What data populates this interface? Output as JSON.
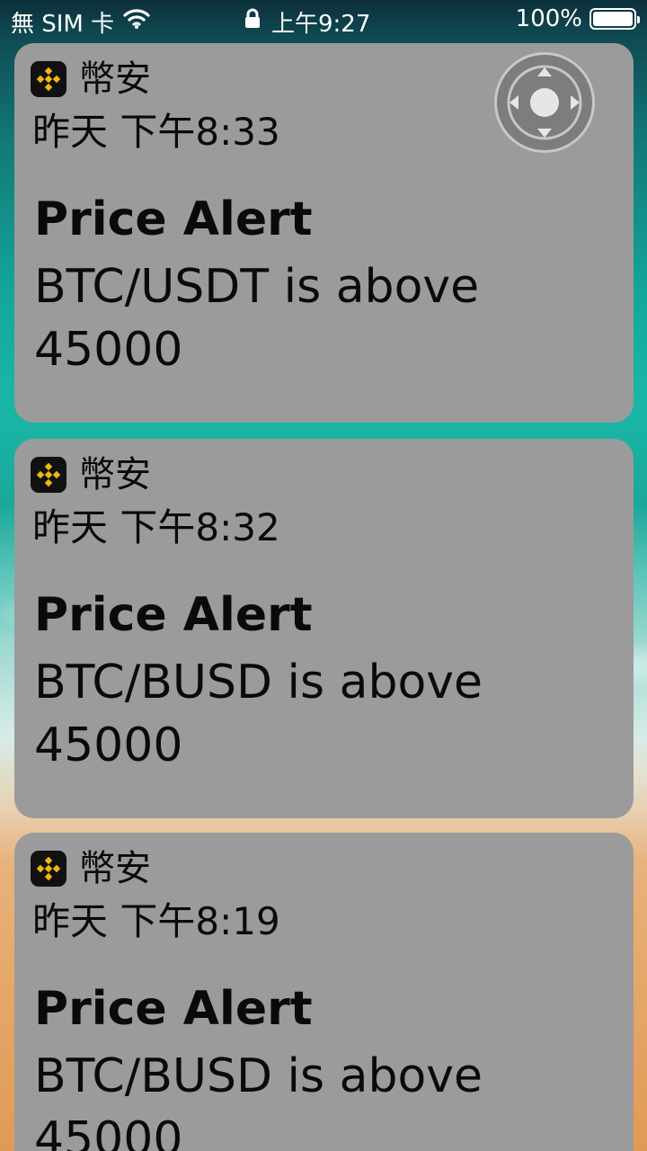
{
  "status_bar": {
    "carrier": "無 SIM 卡",
    "time": "上午9:27",
    "battery_percent": "100%",
    "battery_level": 1.0,
    "icons": [
      "wifi-icon",
      "lock-icon",
      "battery-icon"
    ]
  },
  "notifications": [
    {
      "app_name": "幣安",
      "time": "昨天 下午8:33",
      "title": "Price Alert",
      "body": "BTC/USDT is above 45000"
    },
    {
      "app_name": "幣安",
      "time": "昨天 下午8:32",
      "title": "Price Alert",
      "body": "BTC/BUSD is above 45000"
    },
    {
      "app_name": "幣安",
      "time": "昨天 下午8:19",
      "title": "Price Alert",
      "body": "BTC/BUSD is above 45000"
    }
  ],
  "colors": {
    "card_background": "#9b9b9b",
    "binance_yellow": "#f0b90b",
    "text": "#0a0a0a"
  }
}
